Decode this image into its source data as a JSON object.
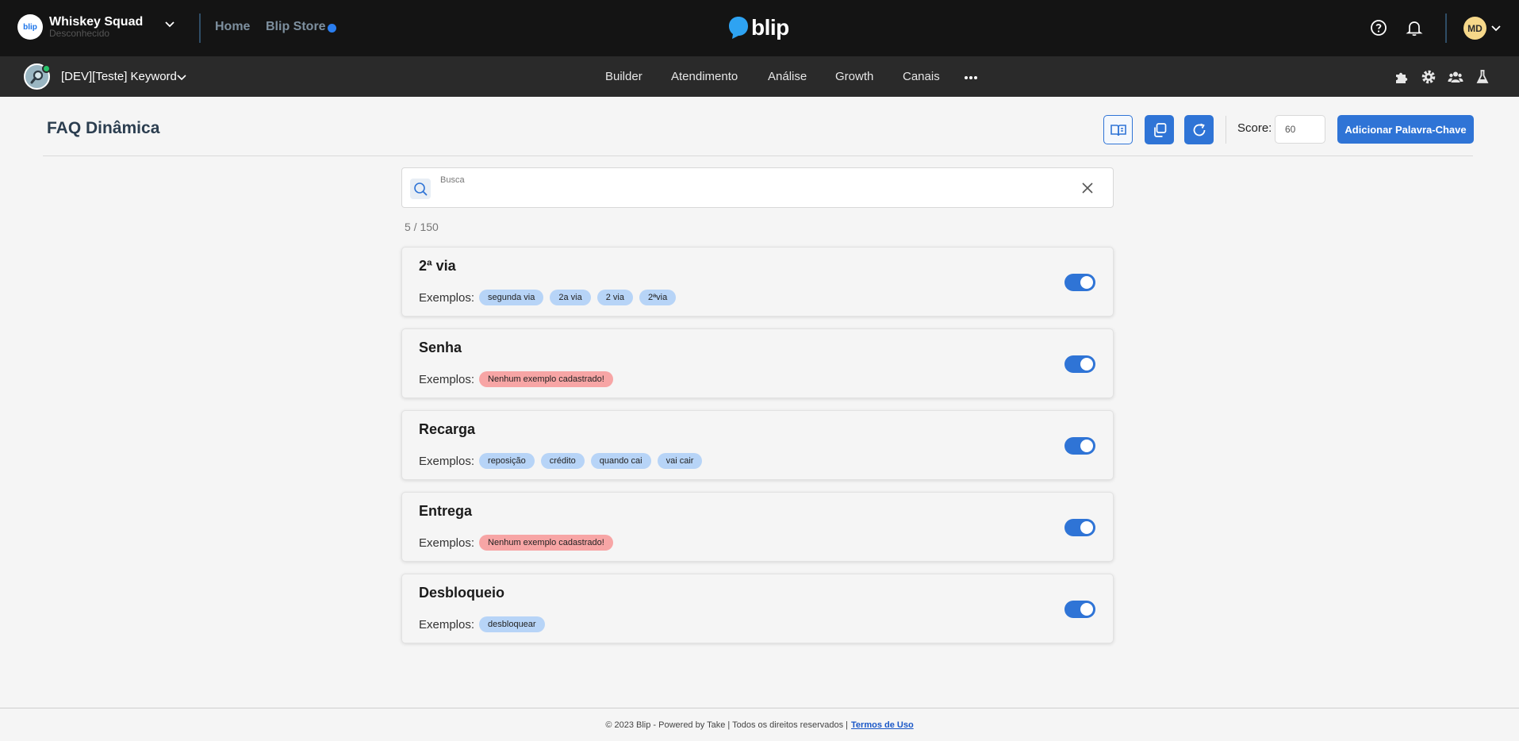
{
  "topbar": {
    "org_name": "Whiskey Squad",
    "org_sub": "Desconhecido",
    "org_logo_text": "blip",
    "links": {
      "home": "Home",
      "store": "Blip Store"
    },
    "brand": "blip",
    "user_initials": "MD"
  },
  "subbar": {
    "bot_name": "[DEV][Teste] Keyword",
    "nav": [
      "Builder",
      "Atendimento",
      "Análise",
      "Growth",
      "Canais"
    ]
  },
  "header": {
    "title": "FAQ Dinâmica",
    "score_label": "Score:",
    "score_value": "60",
    "add_button": "Adicionar Palavra-Chave"
  },
  "search": {
    "label": "Busca",
    "value": "",
    "count": "5 / 150"
  },
  "cards": [
    {
      "title": "2ª via",
      "examples_label": "Exemplos:",
      "examples": [
        "segunda via",
        "2a via",
        "2 via",
        "2ªvia"
      ],
      "empty": false
    },
    {
      "title": "Senha",
      "examples_label": "Exemplos:",
      "examples": [
        "Nenhum exemplo cadastrado!"
      ],
      "empty": true
    },
    {
      "title": "Recarga",
      "examples_label": "Exemplos:",
      "examples": [
        "reposição",
        "crédito",
        "quando cai",
        "vai cair"
      ],
      "empty": false
    },
    {
      "title": "Entrega",
      "examples_label": "Exemplos:",
      "examples": [
        "Nenhum exemplo cadastrado!"
      ],
      "empty": true
    },
    {
      "title": "Desbloqueio",
      "examples_label": "Exemplos:",
      "examples": [
        "desbloquear"
      ],
      "empty": false
    }
  ],
  "footer": {
    "text": "© 2023 Blip - Powered by Take | Todos os direitos reservados |",
    "terms": "Termos de Uso"
  },
  "colors": {
    "accent": "#2f74d6",
    "topbar": "#141414",
    "subbar": "#2a2a2a",
    "tag": "#b7d4f7",
    "tag_empty": "#f7a5a5"
  }
}
